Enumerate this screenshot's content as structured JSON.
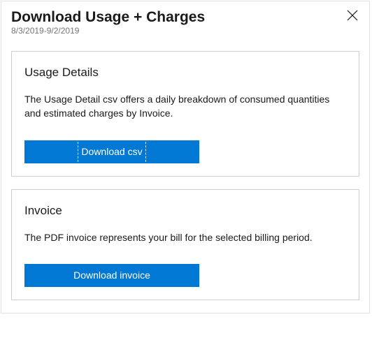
{
  "header": {
    "title": "Download Usage + Charges",
    "date_range": "8/3/2019-9/2/2019"
  },
  "sections": {
    "usage": {
      "title": "Usage Details",
      "description": "The Usage Detail csv offers a daily breakdown of consumed quantities and estimated charges by Invoice.",
      "button_label": "Download csv"
    },
    "invoice": {
      "title": "Invoice",
      "description": "The PDF invoice represents your bill for the selected billing period.",
      "button_label": "Download invoice"
    }
  }
}
